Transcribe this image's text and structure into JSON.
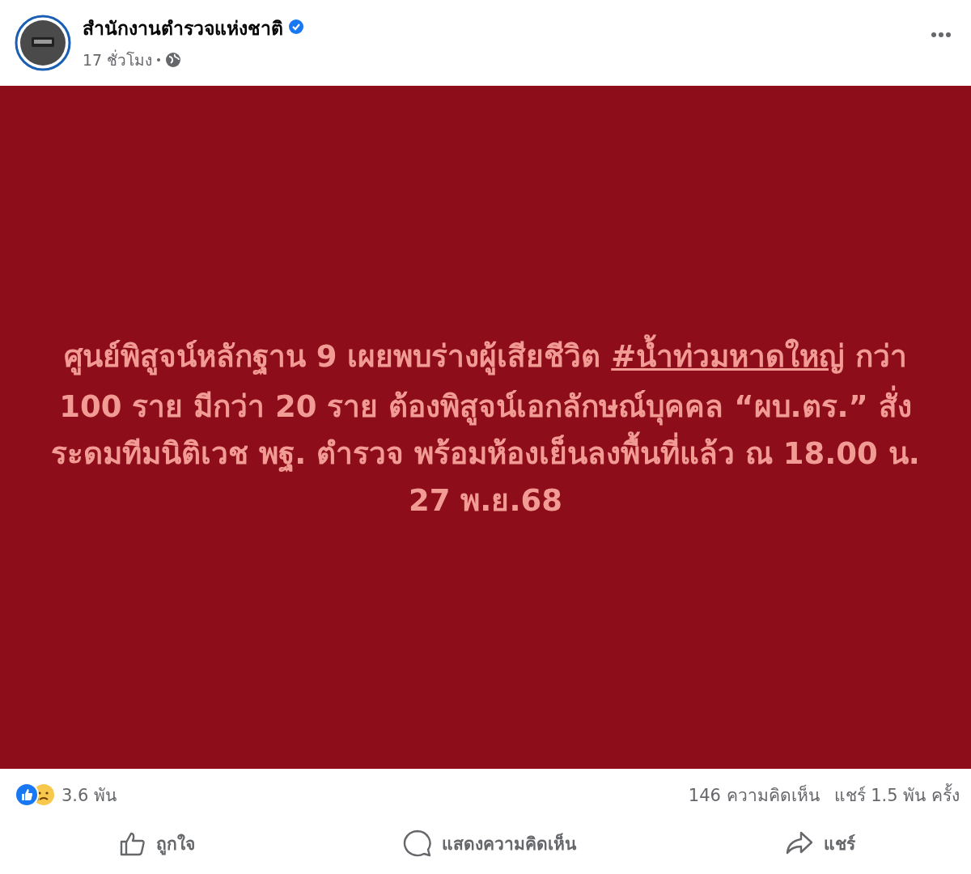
{
  "post": {
    "author": "สำนักงานตำรวจแห่งชาติ",
    "verified": true,
    "time": "17 ชั่วโมง",
    "public": true
  },
  "body": {
    "before": "ศูนย์พิสูจน์หลักฐาน 9 เผยพบร่างผู้เสียชีวิต",
    "hashtag": "#น้ำท่วมหาดใหญ่",
    "after": "กว่า 100 ราย มีกว่า 20 ราย ต้องพิสูจน์เอกลักษณ์บุคคล “ผบ.ตร.” สั่งระดมทีมนิติเวช พฐ. ตำรวจ พร้อมห้องเย็นลงพื้นที่แล้ว ณ 18.00 น. 27 พ.ย.68"
  },
  "stats": {
    "reactions": "3.6 พัน",
    "comments": "146 ความคิดเห็น",
    "shares": "แชร์ 1.5 พัน ครั้ง"
  },
  "actions": [
    {
      "kind": "like",
      "label": "ถูกใจ"
    },
    {
      "kind": "comment",
      "label": "แสดงความคิดเห็น"
    },
    {
      "kind": "share",
      "label": "แชร์"
    }
  ]
}
